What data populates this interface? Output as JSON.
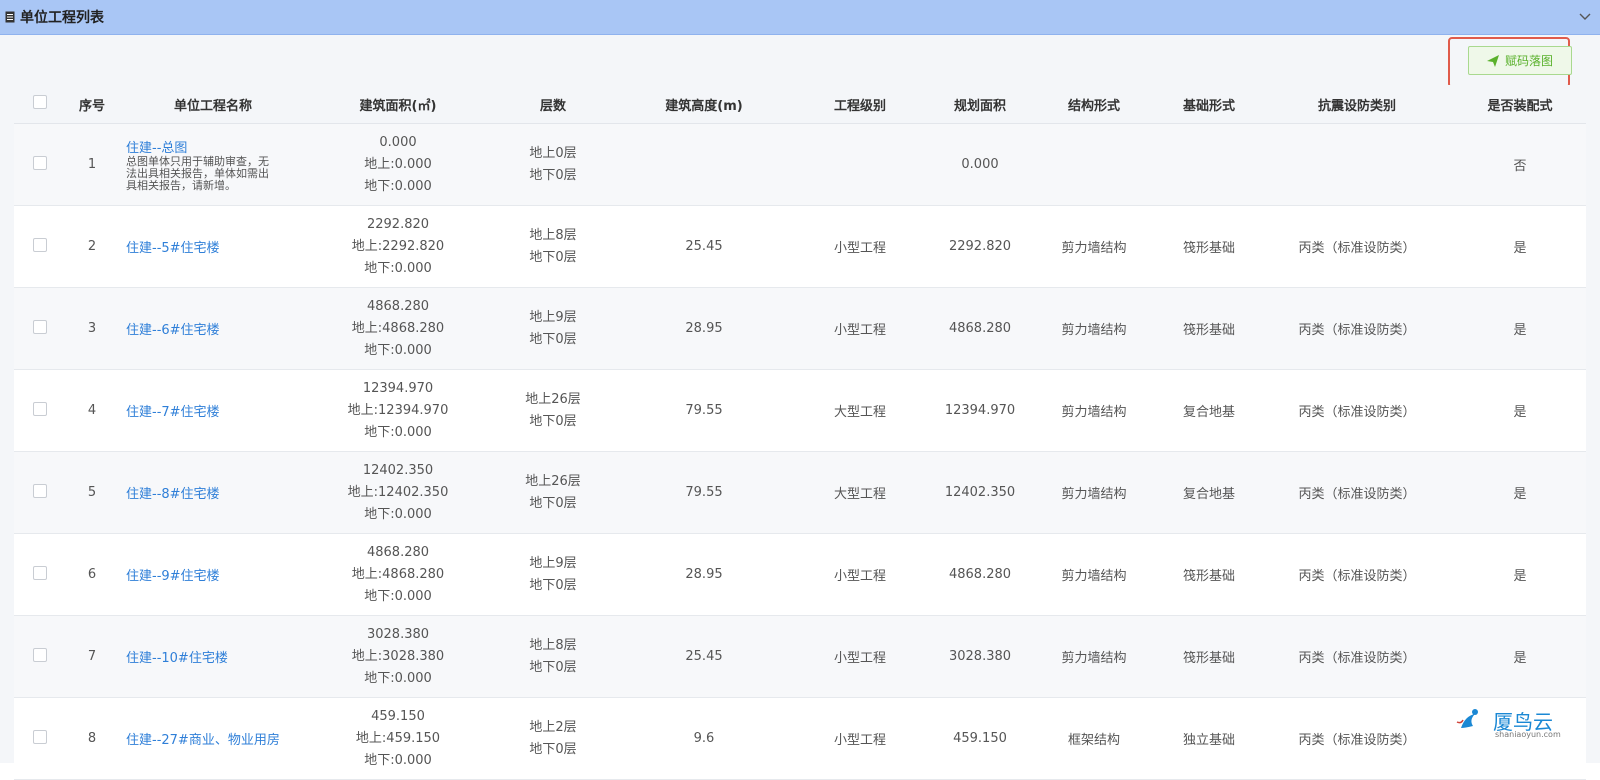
{
  "panel": {
    "title": "单位工程列表",
    "action_button": "赋码落图",
    "highlight_color": "#e05b4b",
    "header_color": "#a9c6f5"
  },
  "columns": [
    "序号",
    "单位工程名称",
    "建筑面积(㎡)",
    "层数",
    "建筑高度(m)",
    "工程级别",
    "规划面积",
    "结构形式",
    "基础形式",
    "抗震设防类别",
    "是否装配式"
  ],
  "rows": [
    {
      "no": "1",
      "name": "住建--总图",
      "note": "总图单体只用于辅助审查，无法出具相关报告，单体如需出具相关报告，请新增。",
      "area": "0.000",
      "area_above": "地上:0.000",
      "area_below": "地下:0.000",
      "floors_above": "地上0层",
      "floors_below": "地下0层",
      "height": "",
      "grade": "",
      "plan_area": "0.000",
      "structure": "",
      "foundation": "",
      "seismic": "",
      "prefab": "否"
    },
    {
      "no": "2",
      "name": "住建--5#住宅楼",
      "note": "",
      "area": "2292.820",
      "area_above": "地上:2292.820",
      "area_below": "地下:0.000",
      "floors_above": "地上8层",
      "floors_below": "地下0层",
      "height": "25.45",
      "grade": "小型工程",
      "plan_area": "2292.820",
      "structure": "剪力墙结构",
      "foundation": "筏形基础",
      "seismic": "丙类（标准设防类）",
      "prefab": "是"
    },
    {
      "no": "3",
      "name": "住建--6#住宅楼",
      "note": "",
      "area": "4868.280",
      "area_above": "地上:4868.280",
      "area_below": "地下:0.000",
      "floors_above": "地上9层",
      "floors_below": "地下0层",
      "height": "28.95",
      "grade": "小型工程",
      "plan_area": "4868.280",
      "structure": "剪力墙结构",
      "foundation": "筏形基础",
      "seismic": "丙类（标准设防类）",
      "prefab": "是"
    },
    {
      "no": "4",
      "name": "住建--7#住宅楼",
      "note": "",
      "area": "12394.970",
      "area_above": "地上:12394.970",
      "area_below": "地下:0.000",
      "floors_above": "地上26层",
      "floors_below": "地下0层",
      "height": "79.55",
      "grade": "大型工程",
      "plan_area": "12394.970",
      "structure": "剪力墙结构",
      "foundation": "复合地基",
      "seismic": "丙类（标准设防类）",
      "prefab": "是"
    },
    {
      "no": "5",
      "name": "住建--8#住宅楼",
      "note": "",
      "area": "12402.350",
      "area_above": "地上:12402.350",
      "area_below": "地下:0.000",
      "floors_above": "地上26层",
      "floors_below": "地下0层",
      "height": "79.55",
      "grade": "大型工程",
      "plan_area": "12402.350",
      "structure": "剪力墙结构",
      "foundation": "复合地基",
      "seismic": "丙类（标准设防类）",
      "prefab": "是"
    },
    {
      "no": "6",
      "name": "住建--9#住宅楼",
      "note": "",
      "area": "4868.280",
      "area_above": "地上:4868.280",
      "area_below": "地下:0.000",
      "floors_above": "地上9层",
      "floors_below": "地下0层",
      "height": "28.95",
      "grade": "小型工程",
      "plan_area": "4868.280",
      "structure": "剪力墙结构",
      "foundation": "筏形基础",
      "seismic": "丙类（标准设防类）",
      "prefab": "是"
    },
    {
      "no": "7",
      "name": "住建--10#住宅楼",
      "note": "",
      "area": "3028.380",
      "area_above": "地上:3028.380",
      "area_below": "地下:0.000",
      "floors_above": "地上8层",
      "floors_below": "地下0层",
      "height": "25.45",
      "grade": "小型工程",
      "plan_area": "3028.380",
      "structure": "剪力墙结构",
      "foundation": "筏形基础",
      "seismic": "丙类（标准设防类）",
      "prefab": "是"
    },
    {
      "no": "8",
      "name": "住建--27#商业、物业用房",
      "note": "",
      "area": "459.150",
      "area_above": "地上:459.150",
      "area_below": "地下:0.000",
      "floors_above": "地上2层",
      "floors_below": "地下0层",
      "height": "9.6",
      "grade": "小型工程",
      "plan_area": "459.150",
      "structure": "框架结构",
      "foundation": "独立基础",
      "seismic": "丙类（标准设防类）",
      "prefab": ""
    }
  ],
  "watermark": {
    "text": "厦鸟云",
    "url": "shaniaoyun.com"
  }
}
